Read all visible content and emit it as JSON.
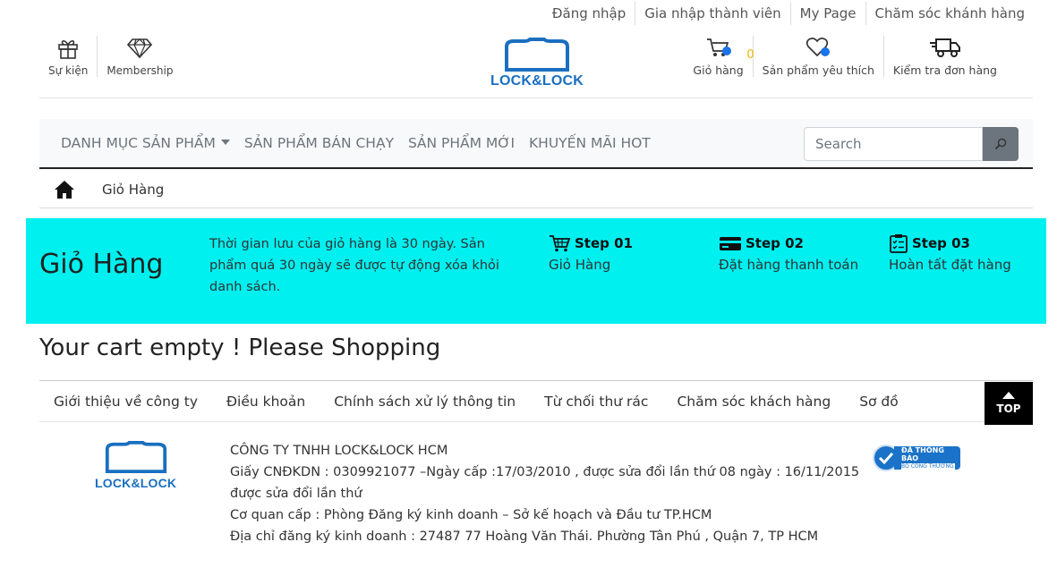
{
  "topbar": {
    "links": [
      "Đăng nhập",
      "Gia nhập thành viên",
      "My Page",
      "Chăm sóc khánh hàng"
    ]
  },
  "header": {
    "left": [
      {
        "label": "Sự kiện",
        "icon": "gift-icon"
      },
      {
        "label": "Membership",
        "icon": "diamond-icon"
      }
    ],
    "logo_text": "LOCK&LOCK",
    "right": [
      {
        "label": "Giỏ hàng",
        "icon": "cart-icon",
        "count": "0"
      },
      {
        "label": "Sản phẩm yêu thích",
        "icon": "heart-icon"
      },
      {
        "label": "Kiểm tra đơn hàng",
        "icon": "truck-icon"
      }
    ]
  },
  "nav": {
    "items": [
      "DANH MỤC SẢN PHẨM",
      "SẢN PHẨM BÁN CHẠY",
      "SẢN PHẨM MỚI",
      "KHUYẾN MÃI HOT"
    ],
    "search_placeholder": "Search"
  },
  "breadcrumb": {
    "current": "Giỏ Hàng"
  },
  "banner": {
    "title": "Giỏ Hàng",
    "notice": "Thời gian lưu của giỏ hàng là 30 ngày. Sản phẩm quá 30 ngày sẽ được tự động xóa khỏi danh sách.",
    "steps": [
      {
        "title": "Step 01",
        "desc": "Giỏ Hàng",
        "icon": "cart-icon"
      },
      {
        "title": "Step 02",
        "desc": "Đặt hàng thanh toán",
        "icon": "credit-card-icon"
      },
      {
        "title": "Step 03",
        "desc": "Hoàn tất đặt hàng",
        "icon": "clipboard-icon"
      }
    ],
    "color": "#00f0f0"
  },
  "empty_message": "Your cart empty ! Please Shopping",
  "footer": {
    "links": [
      "Giới thiệu về công ty",
      "Điều khoản",
      "Chính sách xử lý thông tin",
      "Từ chối thư rác",
      "Chăm sóc khách hàng",
      "Sơ đồ"
    ],
    "top_label": "TOP",
    "logo_text": "LOCK&LOCK",
    "company_lines": [
      "CÔNG TY TNHH LOCK&LOCK HCM",
      "Giấy CNĐKDN : 0309921077 –Ngày cấp :17/03/2010 , được sửa đổi lần thứ 08 ngày : 16/11/2015",
      "được sửa đổi lần thứ",
      "Cơ quan cấp : Phòng Đăng ký kinh doanh – Sở kế hoạch và Đầu tư TP.HCM",
      "Địa chỉ đăng ký kinh doanh : 27487 77 Hoàng Văn Thái. Phường Tân Phú , Quận 7, TP HCM"
    ],
    "badge_title": "ĐÃ THÔNG BÁO",
    "badge_sub": "BỘ CÔNG THƯƠNG"
  }
}
